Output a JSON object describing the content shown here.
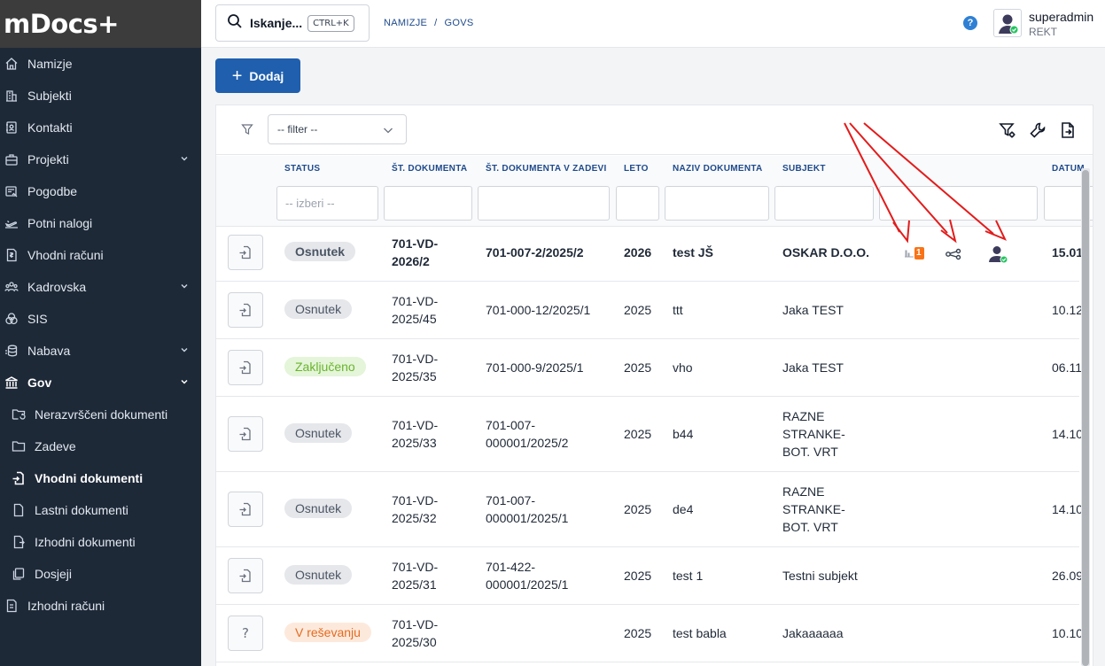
{
  "app": {
    "logo": "mDocs+"
  },
  "sidebar": {
    "items": [
      {
        "label": "Namizje",
        "icon": "home-icon"
      },
      {
        "label": "Subjekti",
        "icon": "building-icon"
      },
      {
        "label": "Kontakti",
        "icon": "contact-book-icon"
      },
      {
        "label": "Projekti",
        "icon": "briefcase-icon"
      },
      {
        "label": "Pogodbe",
        "icon": "contract-icon"
      },
      {
        "label": "Potni nalogi",
        "icon": "plane-icon"
      },
      {
        "label": "Vhodni računi",
        "icon": "invoice-icon"
      },
      {
        "label": "Kadrovska",
        "icon": "people-icon"
      },
      {
        "label": "SIS",
        "icon": "sis-icon"
      },
      {
        "label": "Nabava",
        "icon": "coins-icon"
      },
      {
        "label": "Gov",
        "icon": "gov-icon"
      }
    ],
    "gov_children": [
      {
        "label": "Nerazvrščeni dokumenti",
        "icon": "folder-refresh-icon"
      },
      {
        "label": "Zadeve",
        "icon": "folder-icon"
      },
      {
        "label": "Vhodni dokumenti",
        "icon": "document-in-icon"
      },
      {
        "label": "Lastni dokumenti",
        "icon": "document-icon"
      },
      {
        "label": "Izhodni dokumenti",
        "icon": "document-out-icon"
      },
      {
        "label": "Dosjeji",
        "icon": "files-icon"
      }
    ],
    "last_item": {
      "label": "Izhodni računi",
      "icon": "invoice-out-icon"
    }
  },
  "header": {
    "search_label": "Iskanje...",
    "search_shortcut": "CTRL+K",
    "breadcrumb": [
      "NAMIZJE",
      "/",
      "GOVS"
    ],
    "help_label": "?",
    "user_name": "superadmin",
    "user_org": "REKT"
  },
  "toolbar": {
    "add_label": "Dodaj",
    "filter_placeholder": "-- filter --"
  },
  "table": {
    "columns": [
      "STATUS",
      "ŠT. DOKUMENTA",
      "ŠT. DOKUMENTA V ZADEVI",
      "LETO",
      "NAZIV DOKUMENTA",
      "SUBJEKT",
      "DATUM"
    ],
    "status_filter_placeholder": "-- izberi --",
    "rows": [
      {
        "status": "Osnutek",
        "status_color": "gray",
        "doc_no": [
          "701-VD-",
          "2026/2"
        ],
        "case_no": [
          "701-007-2/2025/2"
        ],
        "year": "2026",
        "title": "test JŠ",
        "subject": [
          "OSKAR D.O.O."
        ],
        "date": "15.01.",
        "attachment_count": "1",
        "bold": true
      },
      {
        "status": "Osnutek",
        "status_color": "gray",
        "doc_no": [
          "701-VD-",
          "2025/45"
        ],
        "case_no": [
          "701-000-12/2025/1"
        ],
        "year": "2025",
        "title": "ttt",
        "subject": [
          "Jaka TEST"
        ],
        "date": "10.12"
      },
      {
        "status": "Zaključeno",
        "status_color": "green",
        "doc_no": [
          "701-VD-",
          "2025/35"
        ],
        "case_no": [
          "701-000-9/2025/1"
        ],
        "year": "2025",
        "title": "vho",
        "subject": [
          "Jaka TEST"
        ],
        "date": "06.11"
      },
      {
        "status": "Osnutek",
        "status_color": "gray",
        "doc_no": [
          "701-VD-",
          "2025/33"
        ],
        "case_no": [
          "701-007-",
          "000001/2025/2"
        ],
        "year": "2025",
        "title": "b44",
        "subject": [
          "RAZNE",
          "STRANKE-",
          "BOT. VRT"
        ],
        "date": "14.10"
      },
      {
        "status": "Osnutek",
        "status_color": "gray",
        "doc_no": [
          "701-VD-",
          "2025/32"
        ],
        "case_no": [
          "701-007-",
          "000001/2025/1"
        ],
        "year": "2025",
        "title": "de4",
        "subject": [
          "RAZNE",
          "STRANKE-",
          "BOT. VRT"
        ],
        "date": "14.10"
      },
      {
        "status": "Osnutek",
        "status_color": "gray",
        "doc_no": [
          "701-VD-",
          "2025/31"
        ],
        "case_no": [
          "701-422-",
          "000001/2025/1"
        ],
        "year": "2025",
        "title": "test 1",
        "subject": [
          "Testni subjekt"
        ],
        "date": "26.09"
      },
      {
        "status": "V reševanju",
        "status_color": "orange",
        "doc_no": [
          "701-VD-",
          "2025/30"
        ],
        "case_no": [],
        "year": "2025",
        "title": "test babla",
        "subject": [
          "Jakaaaaaa"
        ],
        "date": "10.10",
        "row_icon": "?"
      }
    ]
  },
  "colors": {
    "sidebar_bg": "#1e2938",
    "accent": "#1f5fae",
    "annotation_red": "#e31b1b"
  }
}
